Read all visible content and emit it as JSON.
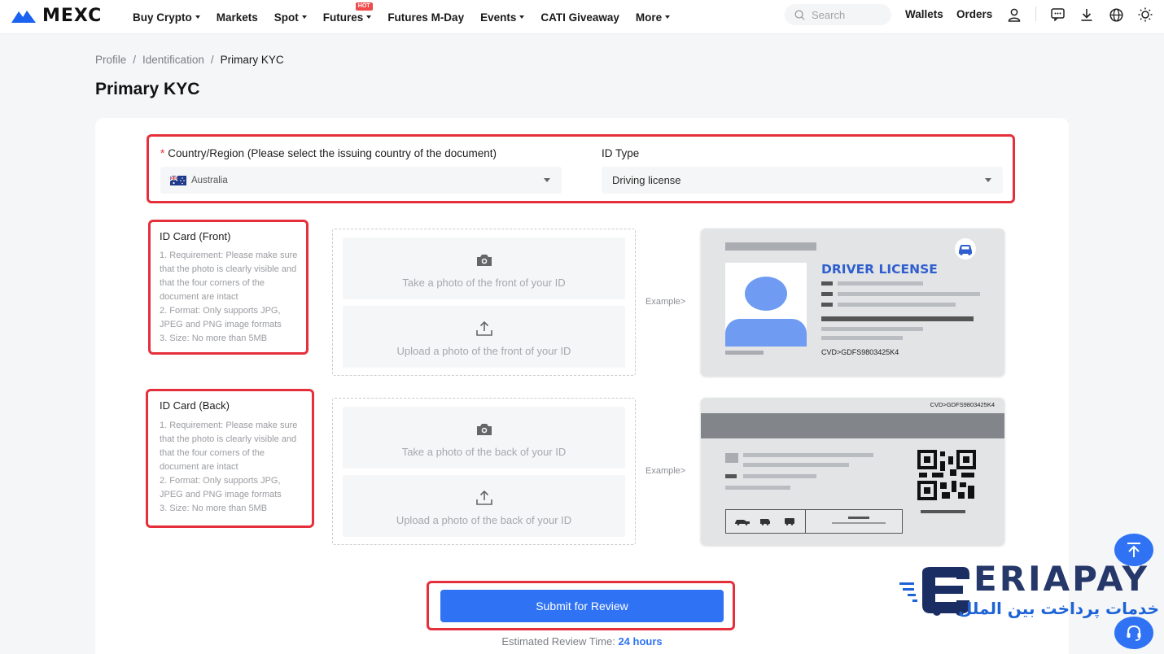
{
  "nav": {
    "logo_text": "MEXC",
    "items": [
      {
        "label": "Buy Crypto",
        "caret": true
      },
      {
        "label": "Markets",
        "caret": false
      },
      {
        "label": "Spot",
        "caret": true
      },
      {
        "label": "Futures",
        "caret": true,
        "badge": "HOT"
      },
      {
        "label": "Futures M-Day",
        "caret": false
      },
      {
        "label": "Events",
        "caret": true
      },
      {
        "label": "CATI Giveaway",
        "caret": false
      },
      {
        "label": "More",
        "caret": true
      }
    ],
    "search_placeholder": "Search",
    "wallets": "Wallets",
    "orders": "Orders"
  },
  "breadcrumb": {
    "items": [
      "Profile",
      "Identification",
      "Primary KYC"
    ],
    "separator": "/"
  },
  "page_title": "Primary KYC",
  "form": {
    "country_label": "Country/Region (Please select the issuing country of the document)",
    "country_required_mark": "*",
    "country_value": "Australia",
    "id_type_label": "ID Type",
    "id_type_value": "Driving license"
  },
  "front": {
    "title": "ID Card (Front)",
    "requirements": "1. Requirement: Please make sure that the photo is clearly visible and that the four corners of the document are intact\n2. Format: Only supports JPG, JPEG and PNG image formats\n3. Size: No more than 5MB",
    "take_photo": "Take a photo of the front of your ID",
    "upload_photo": "Upload a photo of the front of your ID",
    "example": "Example>",
    "sample_title": "DRIVER LICENSE",
    "sample_code": "CVD>GDFS9803425K4"
  },
  "back": {
    "title": "ID Card (Back)",
    "requirements": "1. Requirement: Please make sure that the photo is clearly visible and that the four corners of the document are intact\n2. Format: Only supports JPG, JPEG and PNG image formats\n3. Size: No more than 5MB",
    "take_photo": "Take a photo of the back of your ID",
    "upload_photo": "Upload a photo of the back of your ID",
    "example": "Example>",
    "sample_code": "CVD>GDFS9803425K4"
  },
  "submit_label": "Submit for Review",
  "review_time_label": "Estimated Review Time:",
  "review_time_value": "24 hours",
  "watermark": {
    "brand": "ERIAPAY",
    "tagline": "خدمات پرداخت بین الملل"
  },
  "colors": {
    "accent": "#2f73f4",
    "highlight_red": "#e5303b",
    "logo_blue": "#1c62f0"
  },
  "icons": [
    "search-icon",
    "user-icon",
    "message-icon",
    "download-icon",
    "globe-icon",
    "theme-sun-icon",
    "camera-icon",
    "upload-icon",
    "car-icon",
    "back-to-top-icon",
    "support-icon"
  ]
}
